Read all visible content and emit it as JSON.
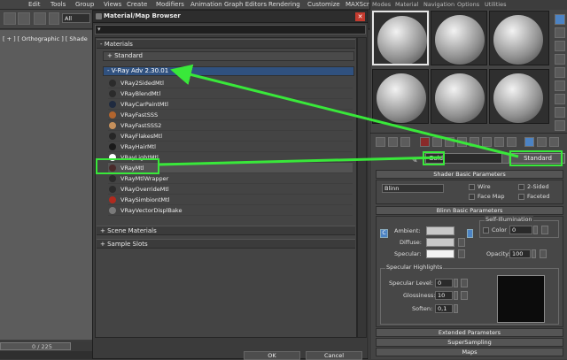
{
  "main_menu": [
    "Edit",
    "Tools",
    "Group",
    "Views",
    "Create",
    "Modifiers",
    "Animation",
    "Graph Editors",
    "Rendering",
    "Customize",
    "MAXScr"
  ],
  "toolbar": {
    "selection_filter": "All"
  },
  "viewport": {
    "label": "[ + ] [ Orthographic ] [ Shade"
  },
  "timeline": {
    "frame": "0 / 225"
  },
  "browser": {
    "title": "Material/Map Browser",
    "close": "✕",
    "search_icon": "search-icon",
    "groups": {
      "materials": "- Materials",
      "standard": "+ Standard",
      "vray": "- V-Ray Adv 2.30.01",
      "scene_materials": "+ Scene Materials",
      "sample_slots": "+ Sample Slots"
    },
    "items": [
      {
        "label": "VRay2SidedMtl",
        "color": "#2b2b2b"
      },
      {
        "label": "VRayBlendMtl",
        "color": "#2b2b2b"
      },
      {
        "label": "VRayCarPaintMtl",
        "color": "#1f2a3f"
      },
      {
        "label": "VRayFastSSS",
        "color": "#b2652e"
      },
      {
        "label": "VRayFastSSS2",
        "color": "#c7915c"
      },
      {
        "label": "VRayFlakesMtl",
        "color": "#262626"
      },
      {
        "label": "VRayHairMtl",
        "color": "#1a1a1a"
      },
      {
        "label": "VRayLightMtl",
        "color": "#ffffff"
      },
      {
        "label": "VRayMtl",
        "color": "#4a2a2a"
      },
      {
        "label": "VRayMtlWrapper",
        "color": "#2b2b2b"
      },
      {
        "label": "VRayOverrideMtl",
        "color": "#2b2b2b"
      },
      {
        "label": "VRaySimbiontMtl",
        "color": "#b12a1e"
      },
      {
        "label": "VRayVectorDisplBake",
        "color": "#7a7a7a"
      }
    ],
    "ok": "OK",
    "cancel": "Cancel"
  },
  "editor": {
    "menu": [
      "Modes",
      "Material",
      "Navigation",
      "Options",
      "Utilities"
    ],
    "material_name": "Gold",
    "material_type": "Standard",
    "shader_basic": {
      "header": "Shader Basic Parameters",
      "shader": "Blinn",
      "wire": "Wire",
      "two_sided": "2-Sided",
      "face_map": "Face Map",
      "faceted": "Faceted"
    },
    "blinn_basic": {
      "header": "Blinn Basic Parameters",
      "self_illumination": "Self-Illumination",
      "color_label": "Color",
      "color_value": "0",
      "ambient": "Ambient:",
      "diffuse": "Diffuse:",
      "specular": "Specular:",
      "opacity_label": "Opacity:",
      "opacity_value": "100",
      "lock_icon": "C"
    },
    "specular_highlights": {
      "header": "Specular Highlights",
      "level_label": "Specular Level:",
      "level_value": "0",
      "gloss_label": "Glossiness:",
      "gloss_value": "10",
      "soften_label": "Soften:",
      "soften_value": "0,1"
    },
    "rollouts": [
      "Extended Parameters",
      "SuperSampling",
      "Maps"
    ]
  },
  "colors": {
    "annotation": "#39e83a",
    "selection": "#30517f"
  }
}
